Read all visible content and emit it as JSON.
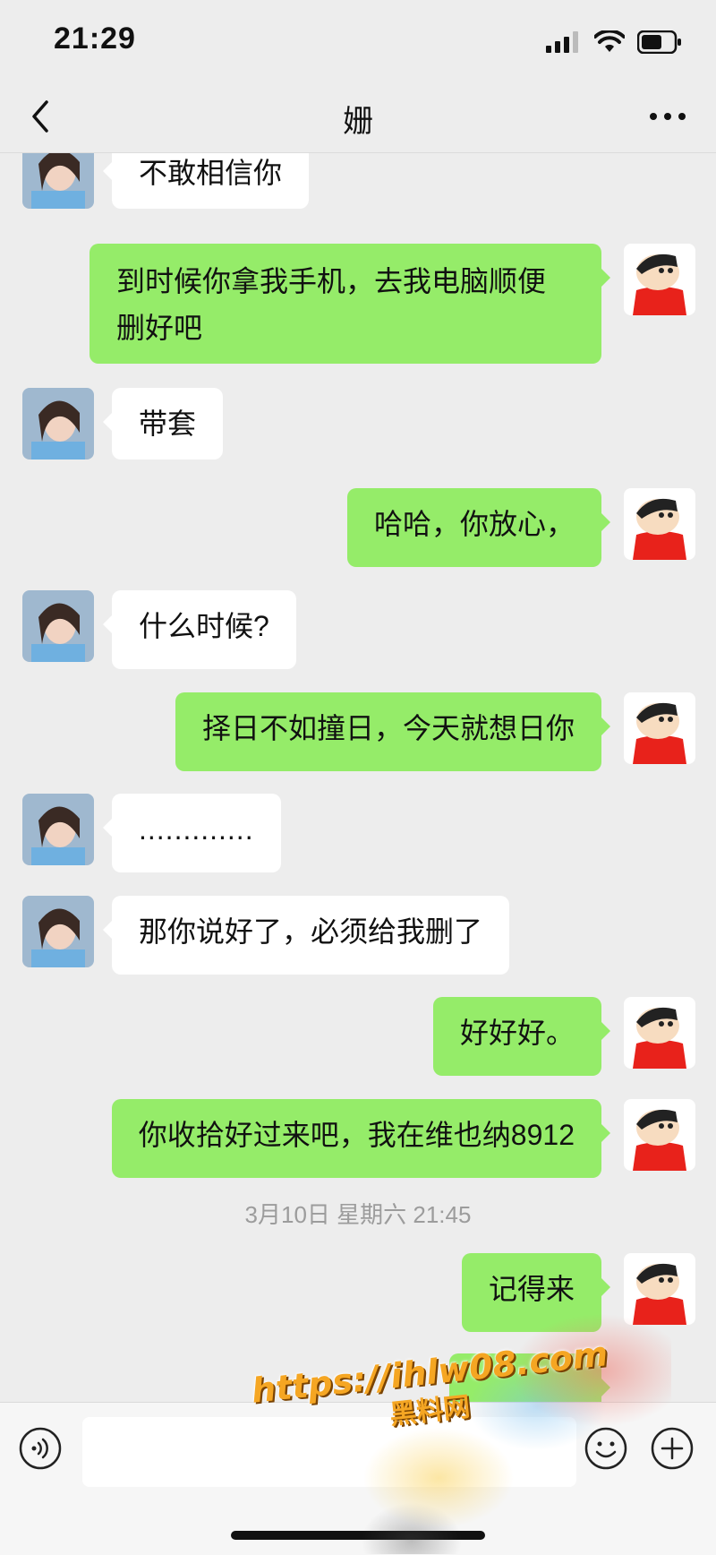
{
  "status_bar": {
    "time": "21:29"
  },
  "header": {
    "title": "姗"
  },
  "messages": [
    {
      "side": "in",
      "text": "不敢相信你"
    },
    {
      "side": "out",
      "line1": "到时候你拿我手机，去我电脑顺便",
      "line2": "删好吧"
    },
    {
      "side": "in",
      "text": "带套"
    },
    {
      "side": "out",
      "text": "哈哈，你放心，"
    },
    {
      "side": "in",
      "text": "什么时候?"
    },
    {
      "side": "out",
      "text": "择日不如撞日，今天就想日你"
    },
    {
      "side": "in",
      "text": "............."
    },
    {
      "side": "in",
      "text": "那你说好了，必须给我删了"
    },
    {
      "side": "out",
      "text": "好好好。"
    },
    {
      "side": "out",
      "text": "你收拾好过来吧，我在维也纳8912"
    },
    {
      "side": "out",
      "text": "记得来"
    }
  ],
  "timestamp": "3月10日 星期六 21:45",
  "watermark": {
    "url": "https://ihlw08.com",
    "name": "黑料网"
  },
  "colors": {
    "bubble_out": "#95ec69",
    "bubble_in": "#ffffff",
    "background": "#ededed"
  }
}
